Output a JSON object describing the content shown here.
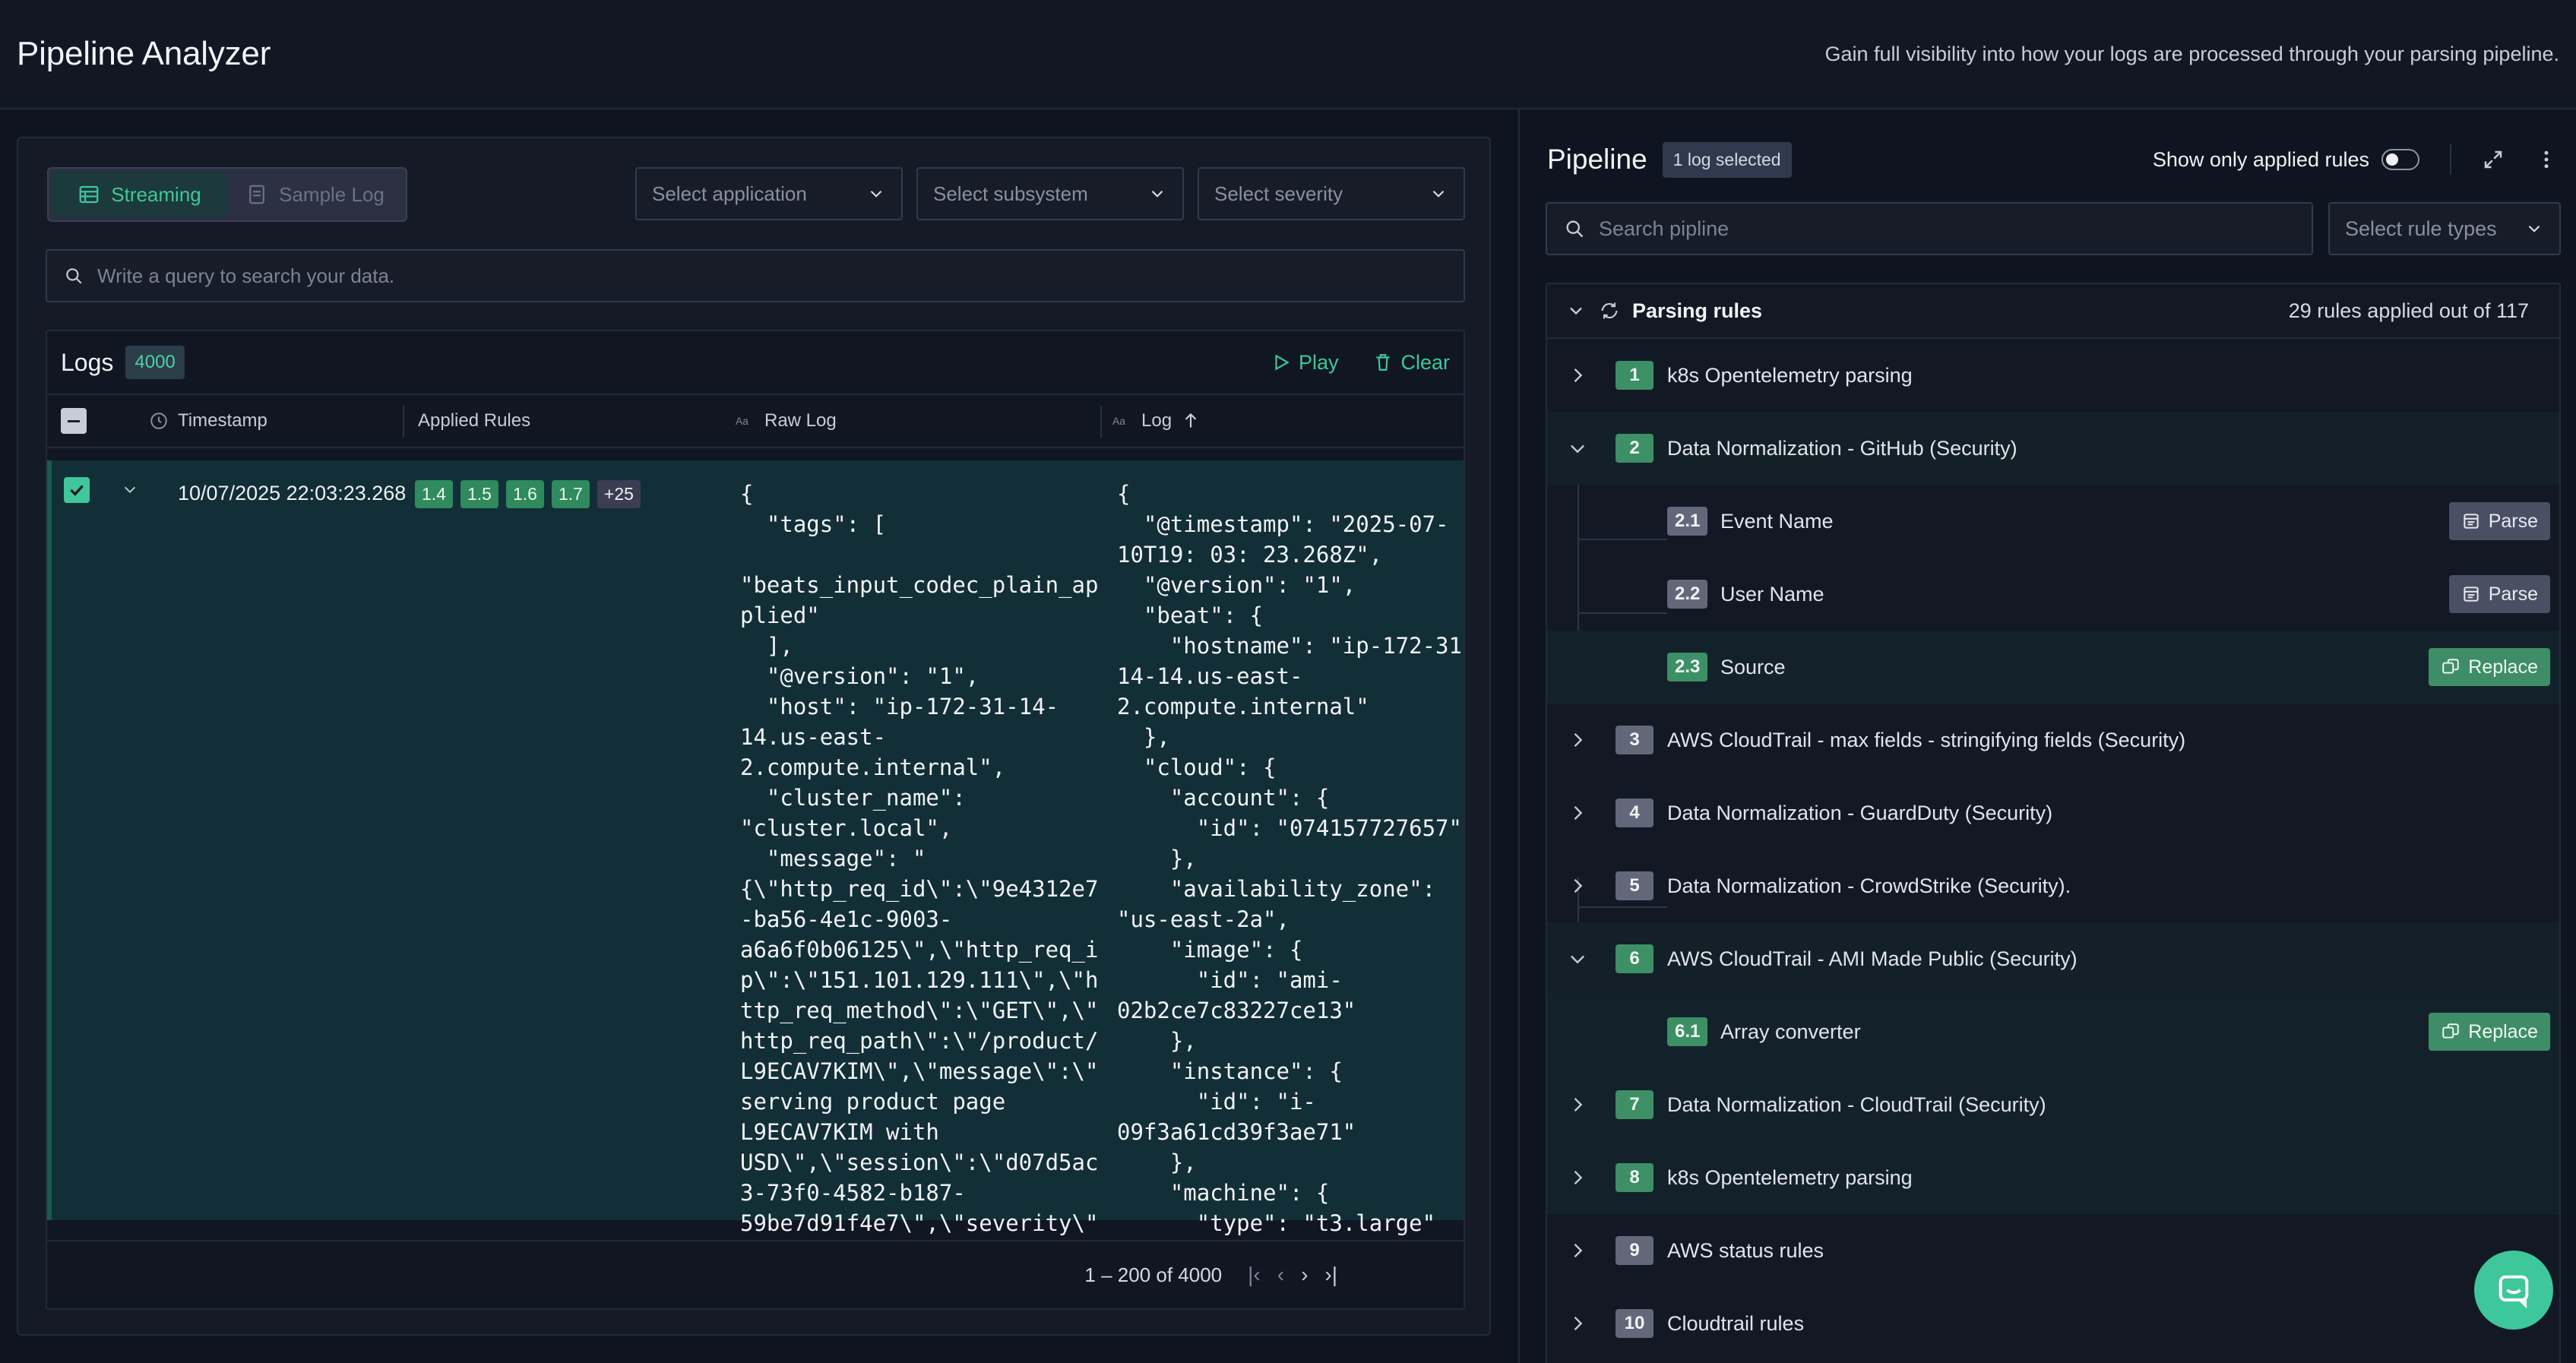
{
  "header": {
    "title": "Pipeline Analyzer",
    "subtitle": "Gain full visibility into how your logs are processed through your parsing pipeline."
  },
  "left": {
    "modes": {
      "streaming": "Streaming",
      "sample": "Sample Log"
    },
    "filters": {
      "application": "Select application",
      "subsystem": "Select subsystem",
      "severity": "Select severity"
    },
    "query_placeholder": "Write a query to search your data.",
    "logs": {
      "title": "Logs",
      "count": "4000",
      "play": "Play",
      "clear": "Clear",
      "columns": {
        "timestamp": "Timestamp",
        "applied_rules": "Applied Rules",
        "raw_log": "Raw Log",
        "log": "Log"
      },
      "row": {
        "timestamp": "10/07/2025 22:03:23.268",
        "rules": [
          "1.4",
          "1.5",
          "1.6",
          "1.7"
        ],
        "more": "+25",
        "raw": "{\n  \"tags\": [\n\n\"beats_input_codec_plain_ap\nplied\"\n  ],\n  \"@version\": \"1\",\n  \"host\": \"ip-172-31-14-\n14.us-east-\n2.compute.internal\",\n  \"cluster_name\":\n\"cluster.local\",\n  \"message\": \"\n{\\\"http_req_id\\\":\\\"9e4312e7\n-ba56-4e1c-9003-\na6a6f0b06125\\\",\\\"http_req_i\np\\\":\\\"151.101.129.111\\\",\\\"h\nttp_req_method\\\":\\\"GET\\\",\\\"\nhttp_req_path\\\":\\\"/product/\nL9ECAV7KIM\\\",\\\"message\\\":\\\"\nserving product page\nL9ECAV7KIM with\nUSD\\\",\\\"session\\\":\\\"d07d5ac\n3-73f0-4582-b187-\n59be7d91f4e7\\\",\\\"severity\\\"",
        "parsed": "{\n  \"@timestamp\": \"2025-07-\n10T19: 03: 23.268Z\",\n  \"@version\": \"1\",\n  \"beat\": {\n    \"hostname\": \"ip-172-31-\n14-14.us-east-\n2.compute.internal\"\n  },\n  \"cloud\": {\n    \"account\": {\n      \"id\": \"074157727657\"\n    },\n    \"availability_zone\":\n\"us-east-2a\",\n    \"image\": {\n      \"id\": \"ami-\n02b2ce7c83227ce13\"\n    },\n    \"instance\": {\n      \"id\": \"i-\n09f3a61cd39f3ae71\"\n    },\n    \"machine\": {\n      \"type\": \"t3.large\""
      },
      "pagination": "1 – 200 of 4000"
    }
  },
  "right": {
    "title": "Pipeline",
    "selected_badge": "1 log selected",
    "toggle_label": "Show only applied rules",
    "search_placeholder": "Search pipline",
    "rule_type_placeholder": "Select rule types",
    "parsing": {
      "title": "Parsing rules",
      "summary": "29 rules applied out of 117",
      "rules": [
        {
          "num": "1",
          "label": "k8s Opentelemetry parsing"
        },
        {
          "num": "2",
          "label": "Data Normalization - GitHub (Security)"
        },
        {
          "num": "2.1",
          "label": "Event Name",
          "action": "Parse"
        },
        {
          "num": "2.2",
          "label": "User Name",
          "action": "Parse"
        },
        {
          "num": "2.3",
          "label": "Source",
          "action": "Replace"
        },
        {
          "num": "3",
          "label": "AWS CloudTrail - max fields - stringifying fields (Security)"
        },
        {
          "num": "4",
          "label": "Data Normalization - GuardDuty (Security)"
        },
        {
          "num": "5",
          "label": "Data Normalization - CrowdStrike (Security)."
        },
        {
          "num": "6",
          "label": "AWS CloudTrail - AMI Made Public (Security)"
        },
        {
          "num": "6.1",
          "label": "Array converter",
          "action": "Replace"
        },
        {
          "num": "7",
          "label": "Data Normalization - CloudTrail (Security)"
        },
        {
          "num": "8",
          "label": "k8s Opentelemetry parsing"
        },
        {
          "num": "9",
          "label": "AWS status rules"
        },
        {
          "num": "10",
          "label": "Cloudtrail rules"
        }
      ]
    }
  },
  "colors": {
    "accent": "#3ec79a",
    "applied": "#3d8f66",
    "not_applied": "#62687a",
    "background": "#0f1520"
  }
}
